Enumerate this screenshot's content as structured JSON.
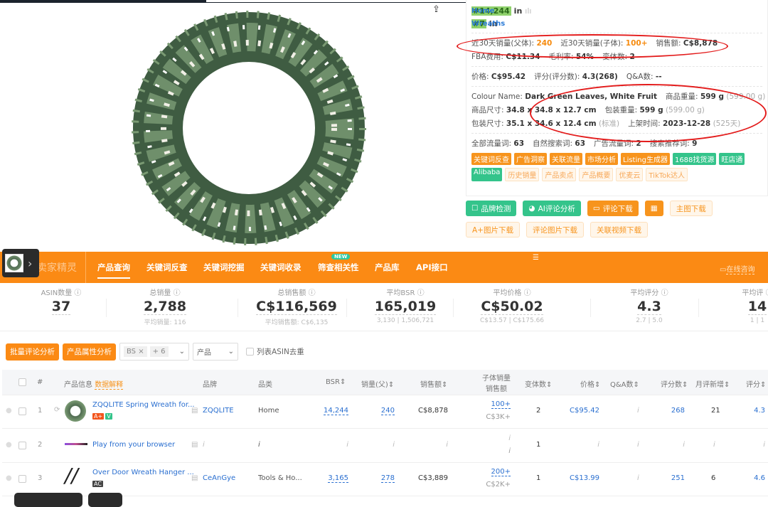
{
  "product": {
    "ranks": [
      {
        "rank": "#14,244",
        "in": "in",
        "cat": "Home"
      },
      {
        "rank": "#7",
        "in": "in",
        "cat": "Wreaths"
      }
    ],
    "sales_line": [
      {
        "k": "近30天销量(父体):",
        "v": "240",
        "o": true
      },
      {
        "k": "近30天销量(子体):",
        "v": "100+",
        "o": true
      },
      {
        "k": "销售额:",
        "v": "C$8,878"
      }
    ],
    "fee_line": [
      {
        "k": "FBA费用:",
        "v": "C$11.34"
      },
      {
        "k": "毛利率:",
        "v": "54%"
      },
      {
        "k": "变体数:",
        "v": "2"
      }
    ],
    "price_line": [
      {
        "k": "价格:",
        "v": "C$95.42"
      },
      {
        "k": "评分(评分数):",
        "v": "4.3(268)"
      },
      {
        "k": "Q&A数:",
        "v": "--"
      }
    ],
    "attr1": [
      {
        "k": "Colour Name:",
        "v": "Dark Green Leaves, White Fruit",
        "g": ""
      },
      {
        "k": "商品重量:",
        "v": "599 g",
        "g": "(599.00 g)"
      }
    ],
    "attr2": [
      {
        "k": "商品尺寸:",
        "v": "34.8 x 34.8 x 12.7 cm",
        "g": ""
      },
      {
        "k": "包装重量:",
        "v": "599 g",
        "g": "(599.00 g)"
      }
    ],
    "attr3": [
      {
        "k": "包装尺寸:",
        "v": "35.1 x 34.6 x 12.4 cm",
        "g": "(标准)"
      },
      {
        "k": "上架时间:",
        "v": "2023-12-28",
        "g": "(525天)"
      }
    ],
    "kw_line": [
      {
        "k": "全部流量词:",
        "v": "63"
      },
      {
        "k": "自然搜索词:",
        "v": "63"
      },
      {
        "k": "广告流量词:",
        "v": "2"
      },
      {
        "k": "搜索推荐词:",
        "v": "9"
      }
    ],
    "tags": [
      {
        "t": "关键词反查",
        "s": "or"
      },
      {
        "t": "广告洞察",
        "s": "or"
      },
      {
        "t": "关联流量",
        "s": "or"
      },
      {
        "t": "市场分析",
        "s": "or"
      },
      {
        "t": "Listing生成器",
        "s": "or"
      },
      {
        "t": "1688找货源",
        "s": "gr"
      },
      {
        "t": "旺店通",
        "s": "gr"
      },
      {
        "t": "Alibaba",
        "s": "gr"
      },
      {
        "t": "历史销量",
        "s": "lt"
      },
      {
        "t": "产品卖点",
        "s": "lt"
      },
      {
        "t": "产品概要",
        "s": "lt"
      },
      {
        "t": "优麦云",
        "s": "lt"
      },
      {
        "t": "TikTok达人",
        "s": "lt"
      }
    ],
    "buttons": [
      {
        "t": "品牌检测",
        "s": "gr",
        "i": "☐"
      },
      {
        "t": "AI评论分析",
        "s": "gr",
        "i": "◕"
      },
      {
        "t": "评论下载",
        "s": "or",
        "i": "▭"
      },
      {
        "t": "",
        "s": "or",
        "i": "▦"
      },
      {
        "t": "主图下载",
        "s": "lt",
        "i": ""
      },
      {
        "t": "A+图片下载",
        "s": "lt",
        "i": ""
      },
      {
        "t": "评论图片下载",
        "s": "lt",
        "i": ""
      },
      {
        "t": "关联视频下载",
        "s": "lt",
        "i": ""
      }
    ]
  },
  "nav": {
    "brand": "卖家精灵",
    "items": [
      "产品查询",
      "关键词反查",
      "关键词挖掘",
      "关键词收录",
      "筛查相关性",
      "产品库",
      "API接口"
    ],
    "new_badge": "NEW",
    "consult": "在线咨询"
  },
  "stats": [
    {
      "label": "ASIN数量",
      "value": "37",
      "sub": ""
    },
    {
      "label": "总销量",
      "value": "2,788",
      "sub": "平均销量: 116"
    },
    {
      "label": "总销售额",
      "value": "C$116,569",
      "sub": "平均销售额: C$6,135"
    },
    {
      "label": "平均BSR",
      "value": "165,019",
      "sub": "3,130 | 1,506,721"
    },
    {
      "label": "平均价格",
      "value": "C$50.02",
      "sub": "C$13.57 | C$175.66"
    },
    {
      "label": "平均评分",
      "value": "4.3",
      "sub": "2.7 | 5.0"
    },
    {
      "label": "平均评",
      "value": "14",
      "sub": "1 | 1"
    }
  ],
  "toolbar": {
    "batch_review": "批量评论分析",
    "attr_analysis": "产品属性分析",
    "chip": "BS ×",
    "chip_more": "+ 6",
    "select": "产品",
    "dedupe": "列表ASIN去重"
  },
  "table": {
    "headers": {
      "num": "#",
      "info": "产品信息",
      "info_link": "数据解释",
      "brand": "品牌",
      "cat": "品类",
      "bsr": "BSR",
      "sales": "销量(父)",
      "rev": "销售额",
      "child1": "子体销量",
      "child2": "销售额",
      "var": "变体数",
      "price": "价格",
      "qa": "Q&A数",
      "reviews": "评分数",
      "monthly": "月评新增",
      "rating": "评分"
    },
    "rows": [
      {
        "num": "1",
        "title": "ZQQLITE Spring Wreath for...",
        "badges": [
          "A+",
          "V"
        ],
        "brand": "ZQQLITE",
        "cat": "Home",
        "bsr": "14,244",
        "sales": "240",
        "rev": "C$8,878",
        "child_sales": "100+",
        "child_rev": "C$3K+",
        "var": "2",
        "price": "C$95.42",
        "qa": "i",
        "reviews": "268",
        "monthly": "21",
        "rating": "4.3"
      },
      {
        "num": "2",
        "title": "Play from your browser",
        "badges": [],
        "brand": "i",
        "cat": "i",
        "bsr": "i",
        "sales": "i",
        "rev": "i",
        "child_sales": "i",
        "child_rev": "i",
        "var": "1",
        "price": "i",
        "qa": "i",
        "reviews": "i",
        "monthly": "i",
        "rating": "i"
      },
      {
        "num": "3",
        "title": "Over Door Wreath Hanger ...",
        "badges": [
          "AC"
        ],
        "brand": "CeAnGye",
        "cat": "Tools & Ho...",
        "bsr": "3,165",
        "sales": "278",
        "rev": "C$3,889",
        "child_sales": "200+",
        "child_rev": "C$2K+",
        "var": "1",
        "price": "C$13.99",
        "qa": "i",
        "reviews": "251",
        "monthly": "6",
        "rating": "4.6"
      }
    ]
  }
}
